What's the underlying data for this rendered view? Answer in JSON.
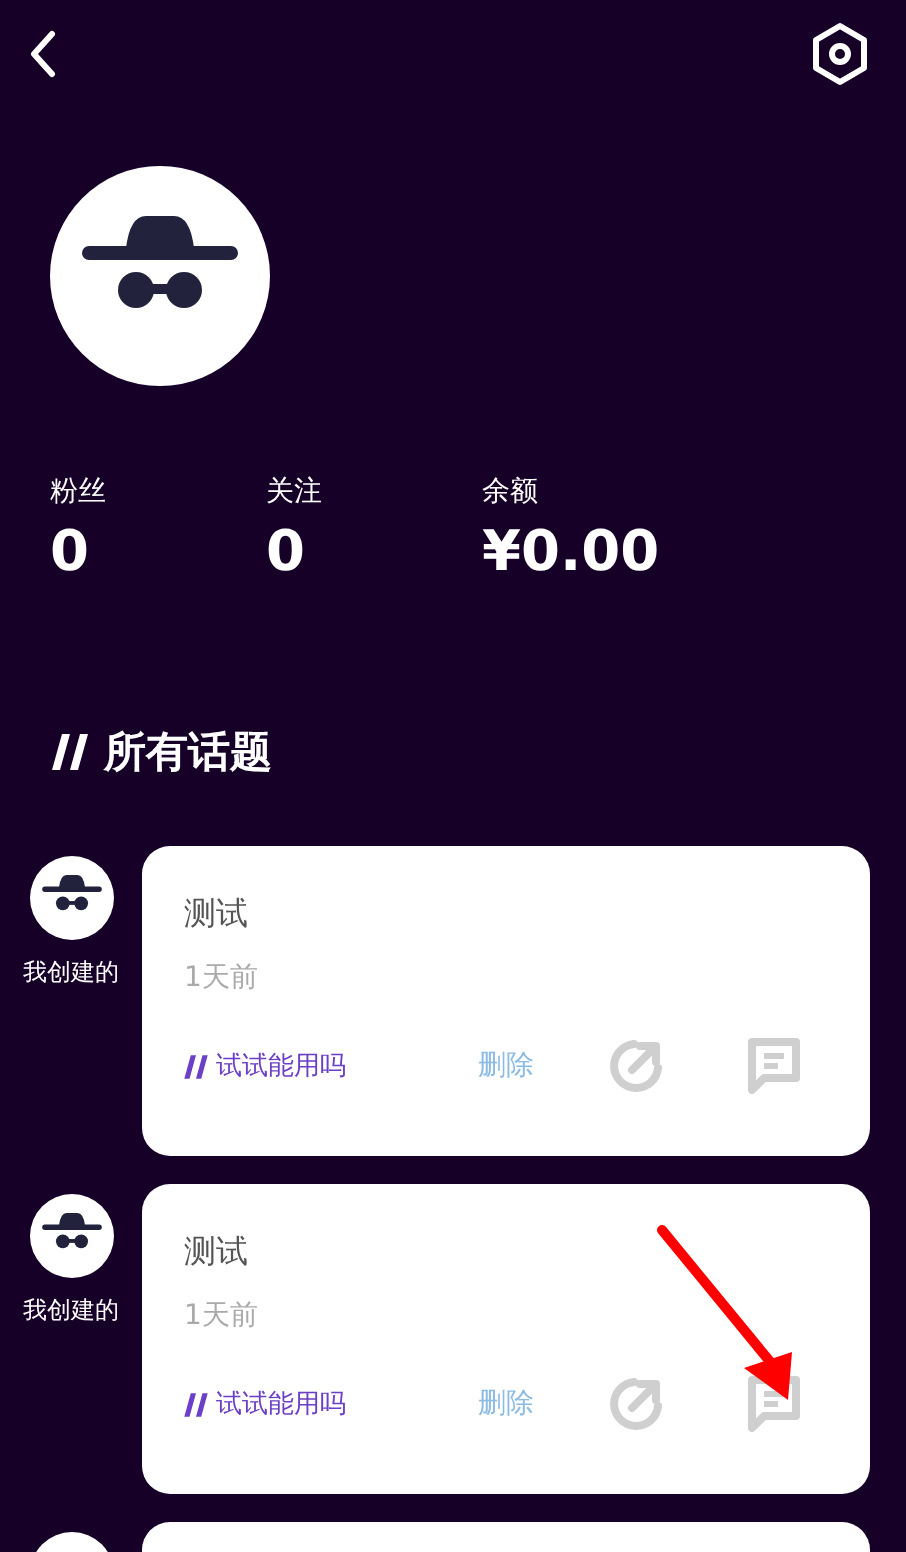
{
  "stats": [
    {
      "label": "粉丝",
      "value": "0"
    },
    {
      "label": "关注",
      "value": "0"
    },
    {
      "label": "余额",
      "value": "¥0.00"
    }
  ],
  "section_title": "所有话题",
  "topics": [
    {
      "author_label": "我创建的",
      "title": "测试",
      "time": "1天前",
      "tag": "试试能用吗",
      "delete": "删除"
    },
    {
      "author_label": "我创建的",
      "title": "测试",
      "time": "1天前",
      "tag": "试试能用吗",
      "delete": "删除"
    }
  ]
}
